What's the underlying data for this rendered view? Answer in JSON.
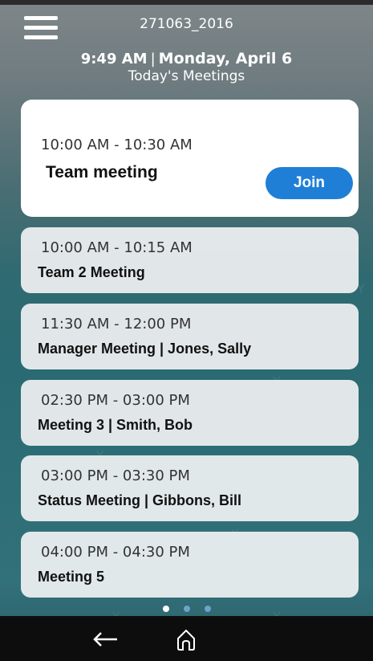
{
  "top_bar": {
    "device_id": "271063_2016",
    "menu_icon": "hamburger-menu-icon"
  },
  "header": {
    "time": "9:49 AM",
    "separator": "|",
    "date": "Monday, April 6",
    "subtitle": "Today's Meetings"
  },
  "meetings": [
    {
      "time": "10:00 AM - 10:30 AM",
      "title": "Team meeting",
      "join_label": "Join"
    },
    {
      "time": "10:00 AM - 10:15 AM",
      "title": "Team 2 Meeting"
    },
    {
      "time": "11:30 AM - 12:00 PM",
      "title": "Manager Meeting | Jones, Sally"
    },
    {
      "time": "02:30 PM - 03:00 PM",
      "title": "Meeting 3 | Smith, Bob"
    },
    {
      "time": "03:00 PM - 03:30 PM",
      "title": "Status Meeting | Gibbons, Bill"
    },
    {
      "time": "04:00 PM - 04:30 PM",
      "title": "Meeting 5"
    }
  ],
  "pager": {
    "current_page": 1,
    "total_pages": 3
  },
  "navbar": {
    "back_icon": "back-arrow-icon",
    "home_icon": "home-icon"
  },
  "colors": {
    "accent": "#1f7fd6",
    "navbar_bg": "#0d0d0d",
    "card_bg": "#ebeeef"
  }
}
